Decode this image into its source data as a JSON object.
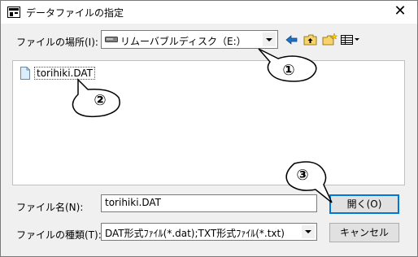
{
  "titlebar": {
    "title": "データファイルの指定",
    "close_glyph": "✕"
  },
  "look_in": {
    "label": "ファイルの場所(I):",
    "value": "リムーバブルディスク（E:）"
  },
  "toolbar": [
    "back-arrow-icon",
    "up-folder-icon",
    "new-folder-icon",
    "view-menu-icon"
  ],
  "file_list": {
    "items": [
      {
        "name": "torihiki.DAT"
      }
    ]
  },
  "file_name": {
    "label": "ファイル名(N):",
    "value": "torihiki.DAT"
  },
  "file_type": {
    "label": "ファイルの種類(T):",
    "value": "DAT形式ﾌｧｲﾙ(*.dat);TXT形式ﾌｧｲﾙ(*.txt)"
  },
  "buttons": {
    "open": "開く(O)",
    "cancel": "キャンセル"
  },
  "callouts": [
    "①",
    "②",
    "③"
  ]
}
